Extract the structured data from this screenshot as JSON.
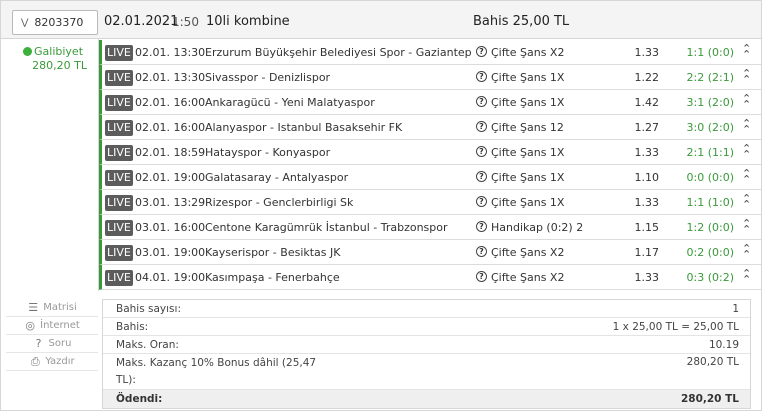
{
  "coupon": {
    "id": "8203370",
    "date": "02.01.2021",
    "time": "1:50",
    "type": "10li kombine",
    "bet": "Bahis 25,00 TL"
  },
  "status": {
    "label": "Galibiyet",
    "amount": "280,20 TL",
    "color": "#3cb13c"
  },
  "matches": [
    {
      "live": "LIVE",
      "datetime": "02.01. 13:30",
      "teams": "Erzurum Büyükşehir Belediyesi Spor - Gaziantep",
      "market": "Çifte Şans X2",
      "odd": "1.33",
      "score": "1:1 (0:0)"
    },
    {
      "live": "LIVE",
      "datetime": "02.01. 13:30",
      "teams": "Sivasspor - Denizlispor",
      "market": "Çifte Şans 1X",
      "odd": "1.22",
      "score": "2:2 (2:1)"
    },
    {
      "live": "LIVE",
      "datetime": "02.01. 16:00",
      "teams": "Ankaragücü - Yeni Malatyaspor",
      "market": "Çifte Şans 1X",
      "odd": "1.42",
      "score": "3:1 (2:0)"
    },
    {
      "live": "LIVE",
      "datetime": "02.01. 16:00",
      "teams": "Alanyaspor - Istanbul Basaksehir FK",
      "market": "Çifte Şans 12",
      "odd": "1.27",
      "score": "3:0 (2:0)"
    },
    {
      "live": "LIVE",
      "datetime": "02.01. 18:59",
      "teams": "Hatayspor - Konyaspor",
      "market": "Çifte Şans 1X",
      "odd": "1.33",
      "score": "2:1 (1:1)"
    },
    {
      "live": "LIVE",
      "datetime": "02.01. 19:00",
      "teams": "Galatasaray - Antalyaspor",
      "market": "Çifte Şans 1X",
      "odd": "1.10",
      "score": "0:0 (0:0)"
    },
    {
      "live": "LIVE",
      "datetime": "03.01. 13:29",
      "teams": "Rizespor - Genclerbirligi Sk",
      "market": "Çifte Şans 1X",
      "odd": "1.33",
      "score": "1:1 (1:0)"
    },
    {
      "live": "LIVE",
      "datetime": "03.01. 16:00",
      "teams": "Centone Karagümrük İstanbul - Trabzonspor",
      "market": "Handikap (0:2) 2",
      "odd": "1.15",
      "score": "1:2 (0:0)"
    },
    {
      "live": "LIVE",
      "datetime": "03.01. 19:00",
      "teams": "Kayserispor - Besiktas JK",
      "market": "Çifte Şans X2",
      "odd": "1.17",
      "score": "0:2 (0:0)"
    },
    {
      "live": "LIVE",
      "datetime": "04.01. 19:00",
      "teams": "Kasımpaşa - Fenerbahçe",
      "market": "Çifte Şans X2",
      "odd": "1.33",
      "score": "0:3 (0:2)"
    }
  ],
  "tools": [
    {
      "icon": "list-icon",
      "label": "Matrisi"
    },
    {
      "icon": "globe-icon",
      "label": "İnternet"
    },
    {
      "icon": "question-icon",
      "label": "Soru"
    },
    {
      "icon": "printer-icon",
      "label": "Yazdır"
    }
  ],
  "summary": {
    "bet_count_label": "Bahis sayısı:",
    "bet_count_value": "1",
    "bets_label": "Bahis:",
    "bets_value": "1 x 25,00 TL = 25,00 TL",
    "max_odds_label": "Maks. Oran:",
    "max_odds_value": "10.19",
    "max_win_label": "Maks. Kazanç  10% Bonus dâhil (25,47 TL):",
    "max_win_value": "280,20 TL",
    "paid_label": "Ödendi:",
    "paid_value": "280,20 TL"
  },
  "colors": {
    "win_green": "#3a9a3a",
    "live_badge": "#5c5c5c"
  }
}
